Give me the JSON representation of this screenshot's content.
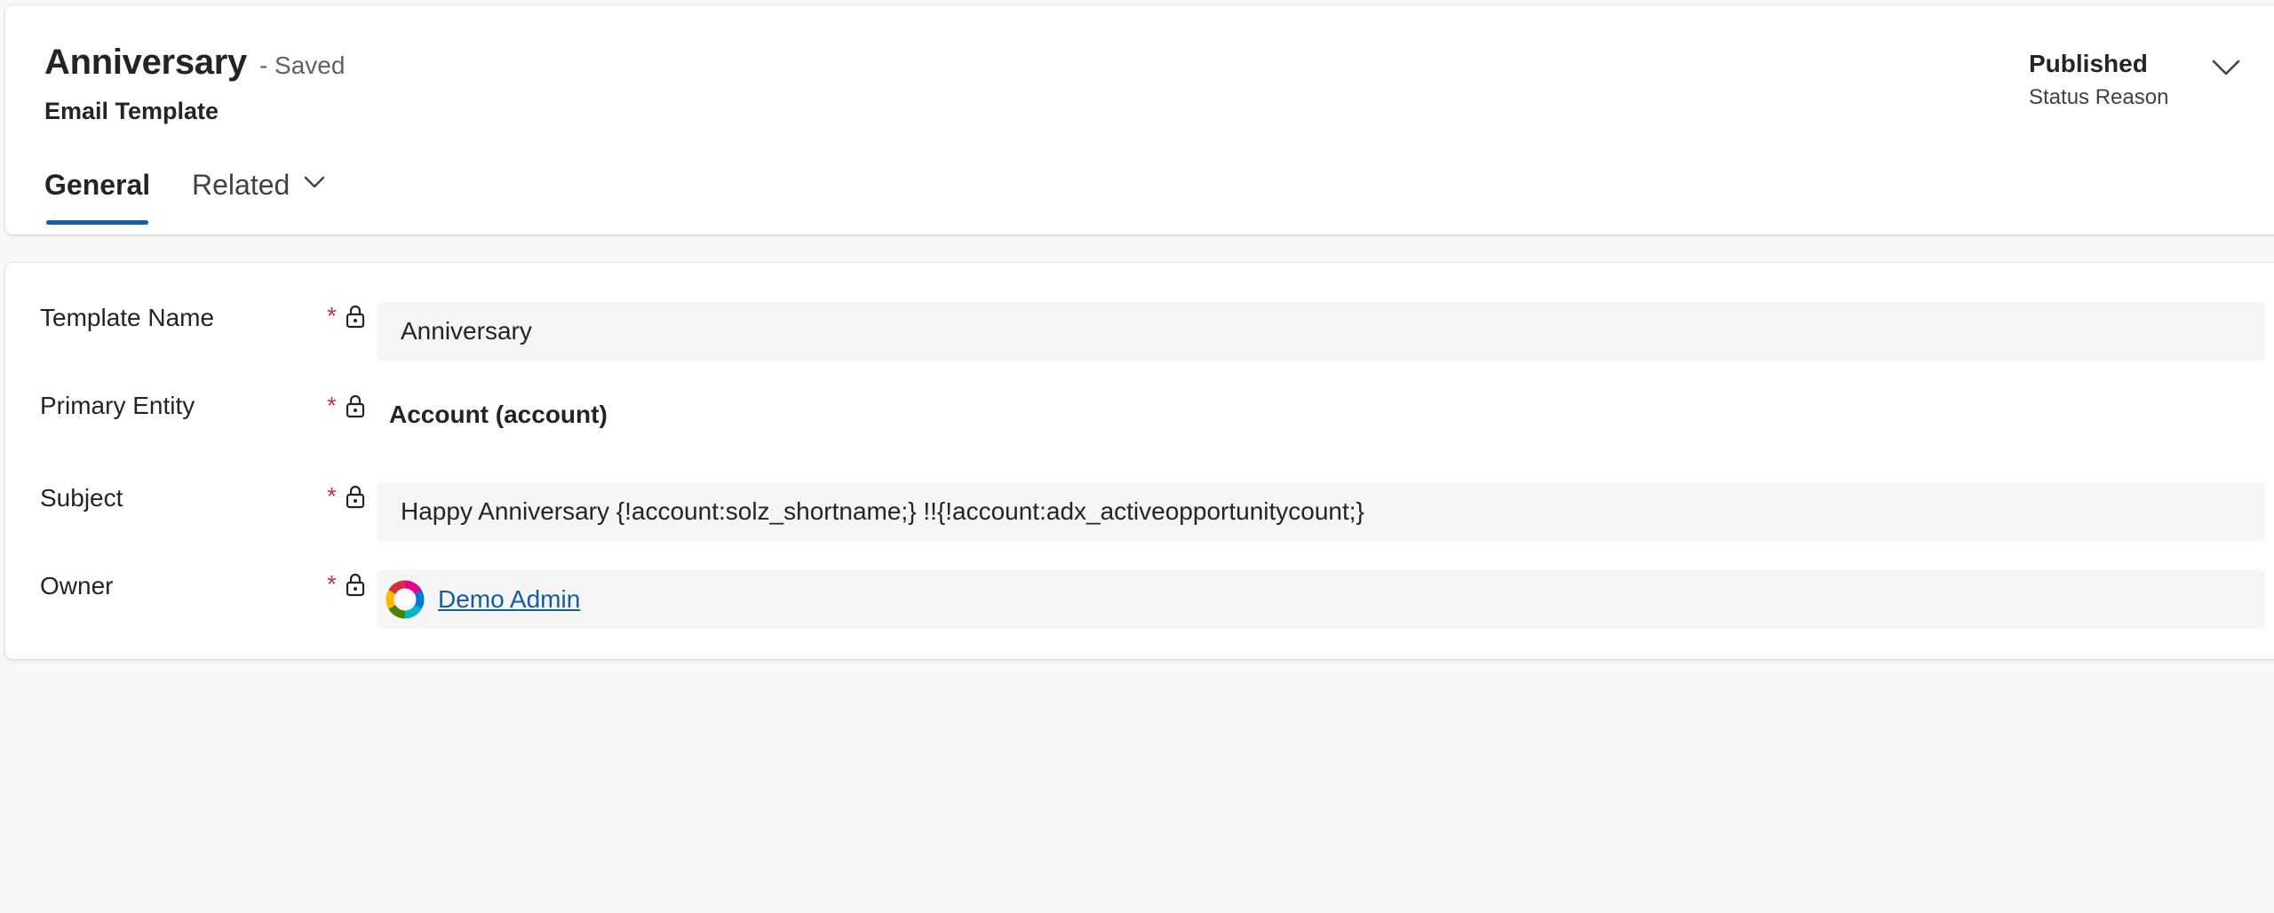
{
  "header": {
    "title": "Anniversary",
    "save_status": "- Saved",
    "entity": "Email Template",
    "status": {
      "value": "Published",
      "label": "Status Reason"
    }
  },
  "tabs": [
    {
      "label": "General",
      "selected": true
    },
    {
      "label": "Related",
      "selected": false
    }
  ],
  "form": {
    "template_name": {
      "label": "Template Name",
      "required": "*",
      "value": "Anniversary"
    },
    "primary_entity": {
      "label": "Primary Entity",
      "required": "*",
      "value": "Account (account)"
    },
    "subject": {
      "label": "Subject",
      "required": "*",
      "value": "Happy Anniversary {!account:solz_shortname;} !!{!account:adx_activeopportunitycount;}"
    },
    "owner": {
      "label": "Owner",
      "required": "*",
      "value": "Demo Admin",
      "avatar_icon": "user-avatar-icon"
    }
  },
  "colors": {
    "accent": "#115ea3",
    "required": "#c4314b",
    "input_bg": "#f5f5f5",
    "page_bg": "#f8f8f8"
  }
}
